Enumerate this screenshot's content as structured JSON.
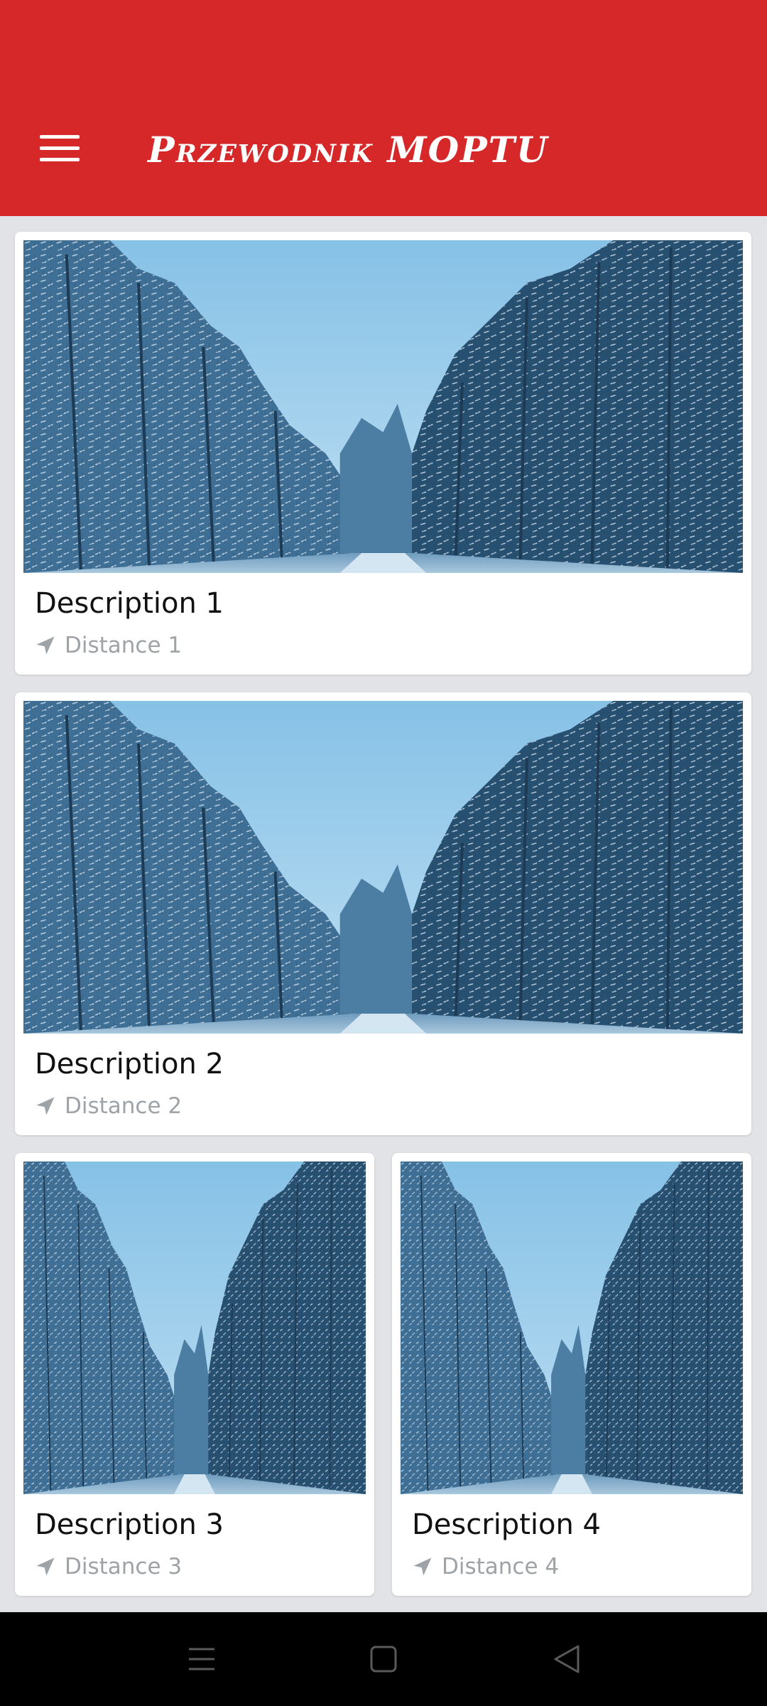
{
  "app_bar": {
    "title": "Przewodnik MOPTU",
    "background": "#d62829",
    "menu_icon": "menu-icon"
  },
  "cards": [
    {
      "title": "Description 1",
      "distance": "Distance 1",
      "image": "snowy-forest-road-photo",
      "distance_icon": "navigation-arrow-icon"
    },
    {
      "title": "Description 2",
      "distance": "Distance 2",
      "image": "snowy-forest-road-photo",
      "distance_icon": "navigation-arrow-icon"
    },
    {
      "title": "Description 3",
      "distance": "Distance 3",
      "image": "snowy-forest-road-photo",
      "distance_icon": "navigation-arrow-icon"
    },
    {
      "title": "Description 4",
      "distance": "Distance 4",
      "image": "snowy-forest-road-photo",
      "distance_icon": "navigation-arrow-icon"
    }
  ],
  "system_nav": {
    "buttons": [
      "recents-icon",
      "home-icon",
      "back-icon"
    ]
  },
  "colors": {
    "accent": "#d62829",
    "page_background": "#e1e3e6",
    "card_background": "#ffffff",
    "meta_text": "#9ea3a8"
  }
}
